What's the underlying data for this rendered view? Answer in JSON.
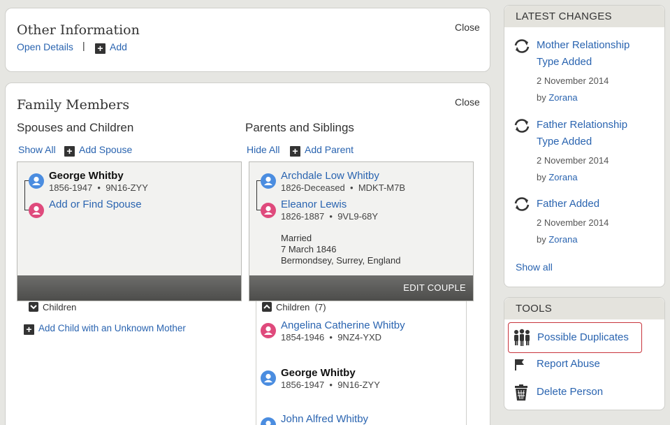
{
  "other_info": {
    "title": "Other Information",
    "close": "Close",
    "open_details": "Open Details",
    "separator": "|",
    "add": "Add"
  },
  "family": {
    "title": "Family Members",
    "close": "Close",
    "spouses": {
      "heading": "Spouses and Children",
      "show_all": "Show All",
      "add_spouse": "Add Spouse",
      "person_name": "George Whitby",
      "person_dates": "1856-1947",
      "person_id": "9N16-ZYY",
      "add_find_spouse": "Add or Find Spouse",
      "children_label": "Children",
      "add_child": "Add Child with an Unknown Mother"
    },
    "parents": {
      "heading": "Parents and Siblings",
      "hide_all": "Hide All",
      "add_parent": "Add Parent",
      "father_name": "Archdale Low Whitby",
      "father_dates": "1826-Deceased",
      "father_id": "MDKT-M7B",
      "mother_name": "Eleanor Lewis",
      "mother_dates": "1826-1887",
      "mother_id": "9VL9-68Y",
      "married_label": "Married",
      "married_date": "7 March 1846",
      "married_place": "Bermondsey, Surrey, England",
      "edit_couple": "EDIT COUPLE",
      "children_label": "Children",
      "children_count": "(7)",
      "children": [
        {
          "name": "Angelina Catherine Whitby",
          "dates": "1854-1946",
          "id": "9NZ4-YXD"
        },
        {
          "name": "George Whitby",
          "dates": "1856-1947",
          "id": "9N16-ZYY"
        },
        {
          "name": "John Alfred Whitby",
          "dates": "",
          "id": ""
        }
      ]
    },
    "dot": "•"
  },
  "latest_changes": {
    "heading": "LATEST CHANGES",
    "items": [
      {
        "title_line1": "Mother Relationship",
        "title_line2": "Type Added",
        "date": "2 November 2014",
        "by": "by",
        "user": "Zorana"
      },
      {
        "title_line1": "Father Relationship",
        "title_line2": "Type Added",
        "date": "2 November 2014",
        "by": "by",
        "user": "Zorana"
      },
      {
        "title_line1": "Father Added",
        "title_line2": "",
        "date": "2 November 2014",
        "by": "by",
        "user": "Zorana"
      }
    ],
    "show_all": "Show all"
  },
  "tools": {
    "heading": "TOOLS",
    "possible_duplicates": "Possible Duplicates",
    "report_abuse": "Report Abuse",
    "delete_person": "Delete Person"
  },
  "colors": {
    "link": "#2a64b0",
    "male": "#4b8de0",
    "female": "#df4a7c",
    "highlight_border": "#c8343c"
  },
  "icons": [
    "person-male-icon",
    "person-female-icon",
    "plus-icon",
    "chevron-down-icon",
    "chevron-up-icon",
    "refresh-icon",
    "people-group-icon",
    "flag-icon",
    "trash-icon"
  ]
}
